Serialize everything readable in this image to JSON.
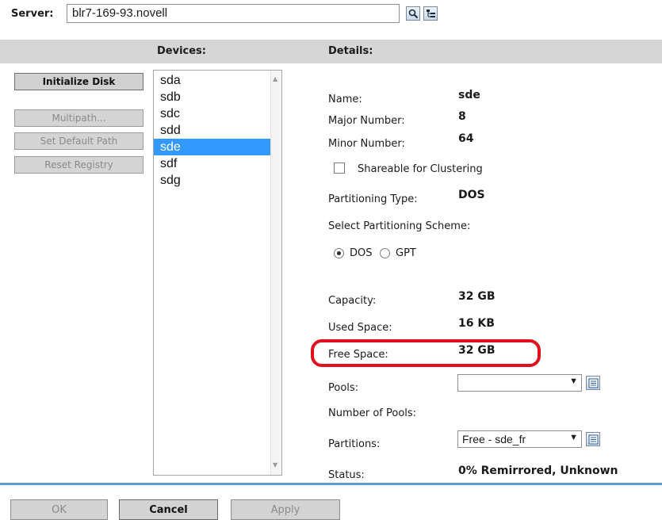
{
  "server": {
    "label": "Server:",
    "value": "blr7-169-93.novell"
  },
  "toolbar": {
    "search_icon": "magnifier-icon",
    "browse_icon": "tree-browse-icon"
  },
  "headers": {
    "devices": "Devices:",
    "details": "Details:"
  },
  "left_buttons": {
    "initialize": "Initialize Disk",
    "multipath": "Multipath...",
    "set_default": "Set Default Path",
    "reset": "Reset Registry"
  },
  "devices": [
    "sda",
    "sdb",
    "sdc",
    "sdd",
    "sde",
    "sdf",
    "sdg"
  ],
  "selected_device": "sde",
  "details": {
    "name_label": "Name:",
    "name_value": "sde",
    "major_label": "Major Number:",
    "major_value": "8",
    "minor_label": "Minor Number:",
    "minor_value": "64",
    "shareable_label": "Shareable for Clustering",
    "shareable_checked": false,
    "ptype_label": "Partitioning Type:",
    "ptype_value": "DOS",
    "scheme_label": "Select Partitioning Scheme:",
    "scheme_dos": "DOS",
    "scheme_gpt": "GPT",
    "scheme_selected": "DOS",
    "capacity_label": "Capacity:",
    "capacity_value": "32 GB",
    "used_label": "Used Space:",
    "used_value": "16 KB",
    "free_label": "Free Space:",
    "free_value": "32 GB",
    "pools_label": "Pools:",
    "pools_value": "",
    "num_pools_label": "Number of Pools:",
    "partitions_label": "Partitions:",
    "partitions_value": "Free - sde_fr",
    "status_label": "Status:",
    "status_value": "0% Remirrored, Unknown"
  },
  "footer": {
    "ok": "OK",
    "cancel": "Cancel",
    "apply": "Apply"
  },
  "colors": {
    "selection": "#3399ff",
    "highlight_ring": "#e0101c",
    "footer_line": "#5b9bd5",
    "header_bar": "#d6d6d6"
  }
}
